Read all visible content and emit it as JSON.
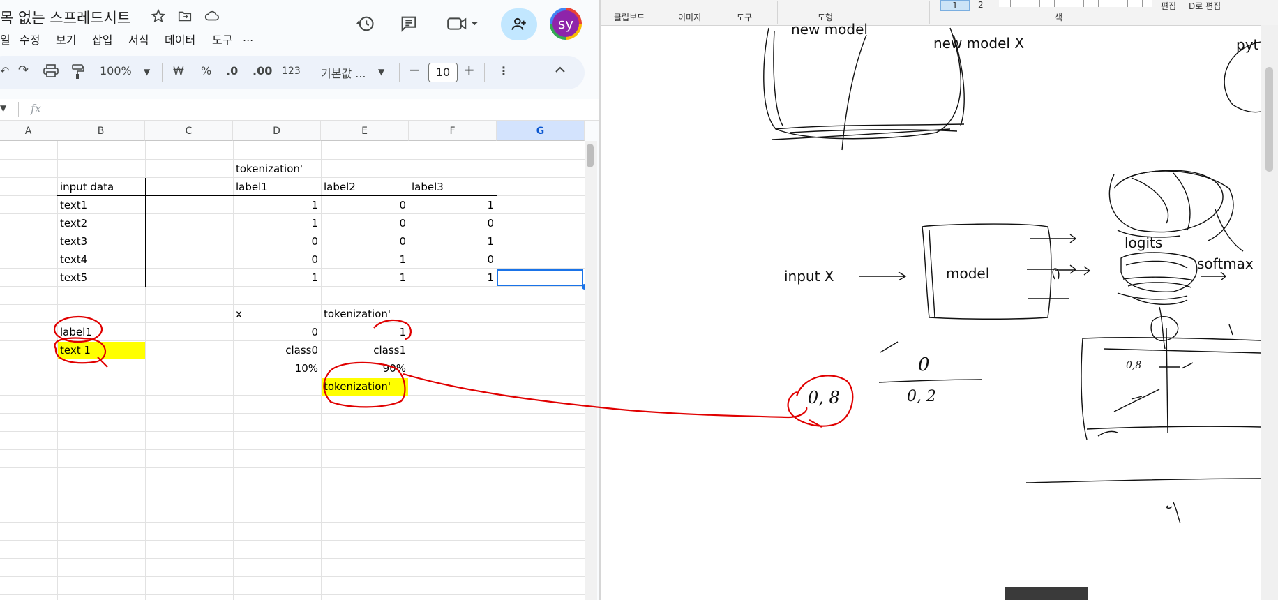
{
  "sheets": {
    "title": "목 없는 스프레드시트",
    "menu": [
      "일",
      "수정",
      "보기",
      "삽입",
      "서식",
      "데이터",
      "도구",
      "..."
    ],
    "toolbar": {
      "zoom": "100%",
      "currency": "₩",
      "percent": "%",
      "dec_decrease": ".0",
      "dec_increase": ".00",
      "format_123": "123",
      "font": "기본값 ...",
      "font_size": "10",
      "minus": "−",
      "plus": "+"
    },
    "formula_label": "fx",
    "avatar_initials": "sy",
    "columns": [
      "A",
      "B",
      "C",
      "D",
      "E",
      "F",
      "G"
    ],
    "cells": {
      "tok_header": "tokenization'",
      "input_data": "input data",
      "label1": "label1",
      "label2": "label2",
      "label3": "label3",
      "rows": [
        {
          "text": "text1",
          "l1": "1",
          "l2": "0",
          "l3": "1"
        },
        {
          "text": "text2",
          "l1": "1",
          "l2": "0",
          "l3": "0"
        },
        {
          "text": "text3",
          "l1": "0",
          "l2": "0",
          "l3": "1"
        },
        {
          "text": "text4",
          "l1": "0",
          "l2": "1",
          "l3": "0"
        },
        {
          "text": "text5",
          "l1": "1",
          "l2": "1",
          "l3": "1"
        }
      ],
      "x": "x",
      "tok_header2": "tokenization'",
      "b_label1": "label1",
      "d_zero": "0",
      "e_one": "1",
      "b_text1": "text 1",
      "d_class0": "class0",
      "e_class1": "class1",
      "d_pct": "10%",
      "e_pct": "90%",
      "e_tok": "tokenization'"
    }
  },
  "paint": {
    "ribbon": [
      "클립보드",
      "이미지",
      "도구",
      "도형",
      "색",
      "편집",
      "D로 편집"
    ],
    "ribbon_nums": [
      "1",
      "2"
    ],
    "texts": {
      "new_model": "new model",
      "new_model_x": "new model X",
      "pyt": "pyt",
      "input_x": "input X",
      "model": "model",
      "logits": "logits",
      "softmax": "softmax",
      "zero": "0",
      "zero_two": "0, 2",
      "zero_eight": "0, 8",
      "zero_eight_small": "0,8"
    }
  },
  "colors": {
    "highlight": "#ffff00",
    "annotation_red": "#e00000",
    "selection_blue": "#1a73e8",
    "share_button": "#c2e7ff",
    "avatar_bg": "#8e24aa"
  }
}
